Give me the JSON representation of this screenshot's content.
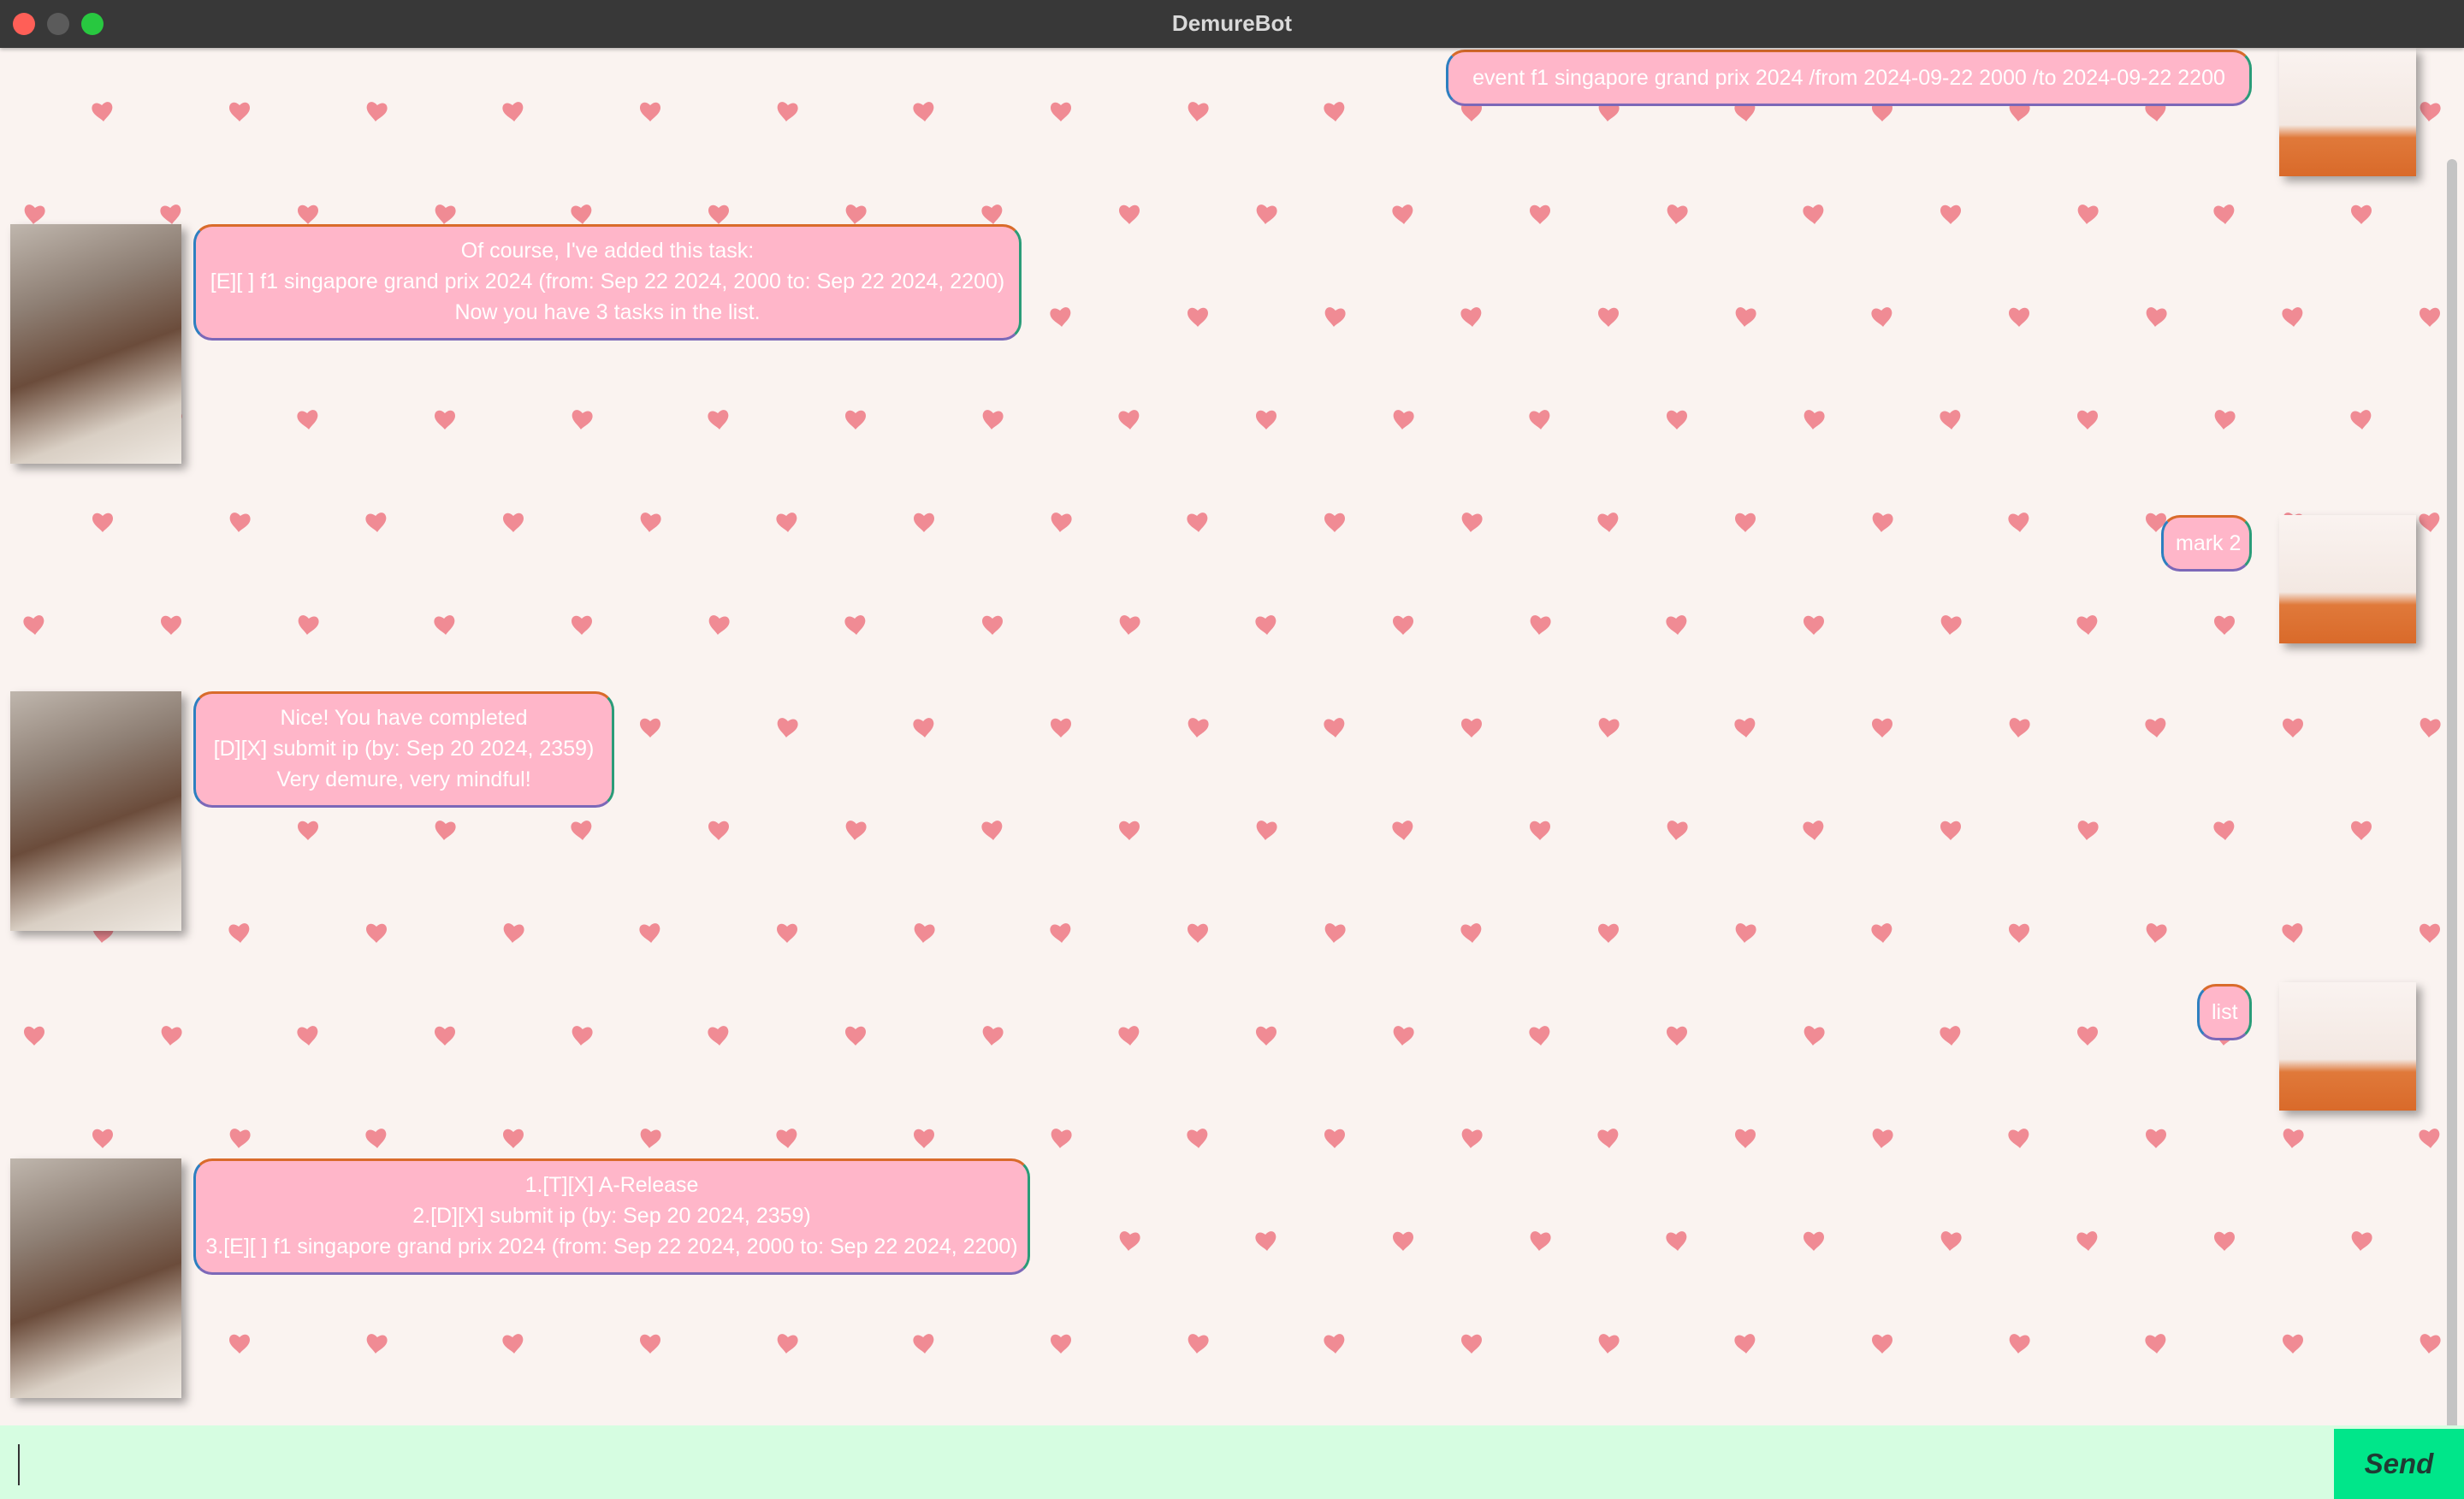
{
  "window": {
    "title": "DemureBot"
  },
  "colors": {
    "background": "#faf3f0",
    "heart": "#f08b94",
    "bubble_fill": "#ffb6c9",
    "bubble_text": "#ffffff",
    "input_bar": "#d6fde1",
    "send_button": "#00e68a"
  },
  "conversation": [
    {
      "sender": "user",
      "lines": [
        "event f1 singapore grand prix 2024 /from 2024-09-22 2000 /to 2024-09-22 2200"
      ]
    },
    {
      "sender": "bot",
      "lines": [
        "Of course, I've added this task:",
        "[E][ ] f1 singapore grand prix 2024 (from: Sep 22 2024, 2000 to: Sep 22 2024, 2200)",
        "Now you have 3 tasks in the list."
      ]
    },
    {
      "sender": "user",
      "lines": [
        "mark 2"
      ]
    },
    {
      "sender": "bot",
      "lines": [
        "Nice! You have completed",
        "[D][X] submit ip (by: Sep 20 2024, 2359)",
        "Very demure, very mindful!"
      ]
    },
    {
      "sender": "user",
      "lines": [
        "list"
      ]
    },
    {
      "sender": "bot",
      "lines": [
        "1.[T][X] A-Release",
        "2.[D][X] submit ip (by: Sep 20 2024, 2359)",
        "3.[E][ ] f1 singapore grand prix 2024 (from: Sep 22 2024, 2000 to: Sep 22 2024, 2200)"
      ]
    }
  ],
  "input": {
    "value": "",
    "placeholder": ""
  },
  "send_button": {
    "label": "Send"
  }
}
